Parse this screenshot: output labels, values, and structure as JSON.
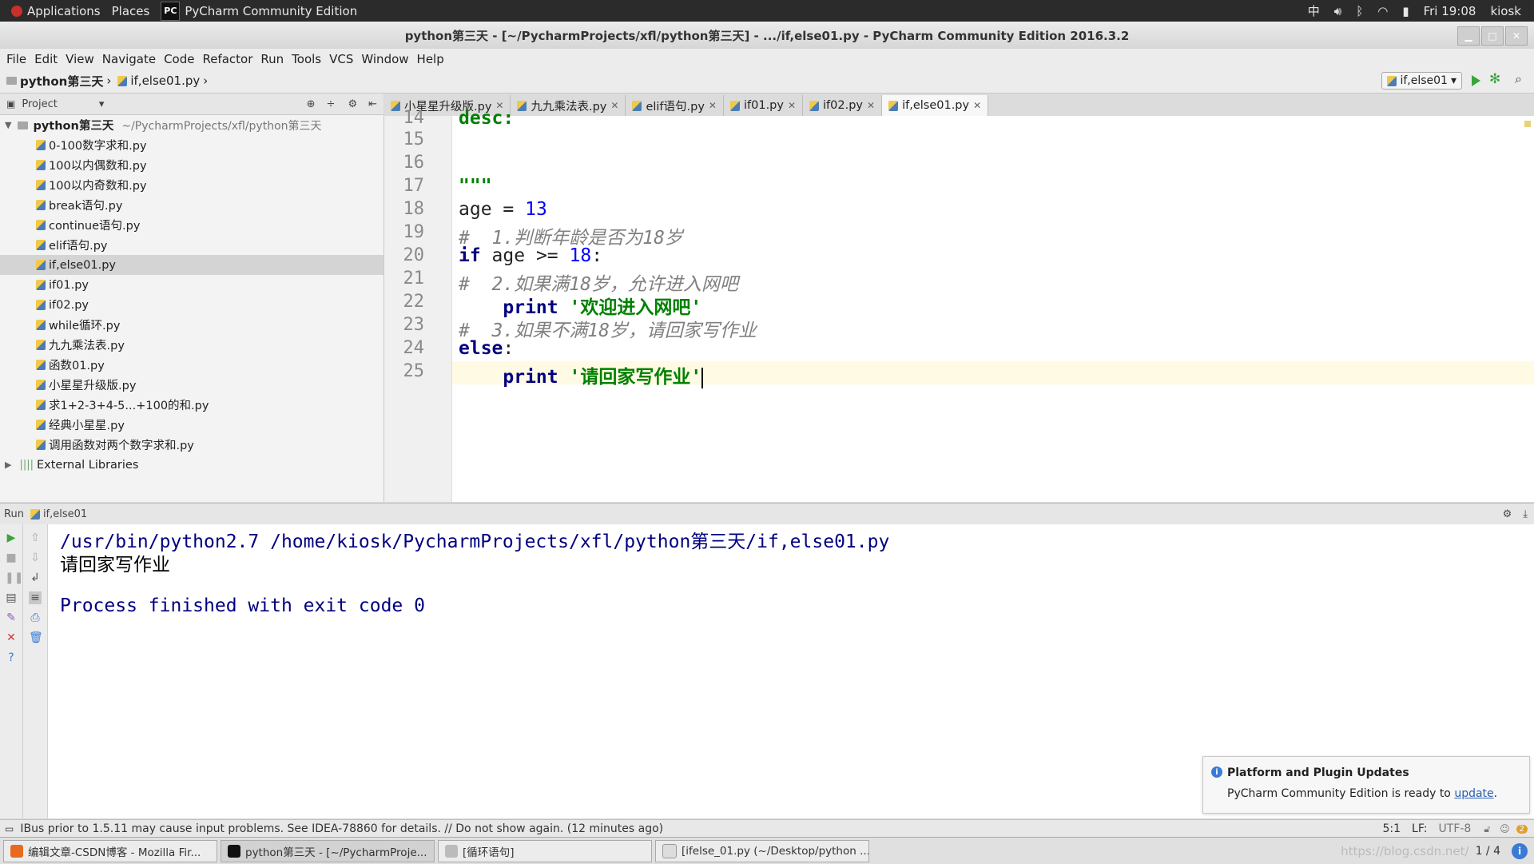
{
  "topbar": {
    "applications": "Applications",
    "places": "Places",
    "app_name": "PyCharm Community Edition",
    "app_icon_text": "PC",
    "input_method": "中",
    "clock": "Fri 19:08",
    "user": "kiosk"
  },
  "window": {
    "title": "python第三天 - [~/PycharmProjects/xfl/python第三天] - .../if,else01.py - PyCharm Community Edition 2016.3.2"
  },
  "menu": [
    "File",
    "Edit",
    "View",
    "Navigate",
    "Code",
    "Refactor",
    "Run",
    "Tools",
    "VCS",
    "Window",
    "Help"
  ],
  "breadcrumb": {
    "project": "python第三天",
    "file": "if,else01.py"
  },
  "run_config": "if,else01",
  "project_panel": {
    "label": "Project",
    "root_name": "python第三天",
    "root_path": "~/PycharmProjects/xfl/python第三天",
    "files": [
      "0-100数字求和.py",
      "100以内偶数和.py",
      "100以内奇数和.py",
      "break语句.py",
      "continue语句.py",
      "elif语句.py",
      "if,else01.py",
      "if01.py",
      "if02.py",
      "while循环.py",
      "九九乘法表.py",
      "函数01.py",
      "小星星升级版.py",
      "求1+2-3+4-5...+100的和.py",
      "经典小星星.py",
      "调用函数对两个数字求和.py"
    ],
    "selected_index": 6,
    "external": "External Libraries"
  },
  "tabs": [
    {
      "label": "小星星升级版.py",
      "active": false
    },
    {
      "label": "九九乘法表.py",
      "active": false
    },
    {
      "label": "elif语句.py",
      "active": false
    },
    {
      "label": "if01.py",
      "active": false
    },
    {
      "label": "if02.py",
      "active": false
    },
    {
      "label": "if,else01.py",
      "active": true
    }
  ],
  "editor": {
    "line_numbers": [
      "14",
      "15",
      "16",
      "17",
      "18",
      "19",
      "20",
      "21",
      "22",
      "23",
      "24",
      "25"
    ],
    "l14": "desc:",
    "l17": "\"\"\"",
    "l18_var": "age = ",
    "l18_num": "13",
    "l19": "#  1.判断年龄是否为18岁",
    "l20_kw": "if",
    "l20_mid": " age >= ",
    "l20_num": "18",
    "l20_end": ":",
    "l21": "#  2.如果满18岁，允许进入网吧",
    "l22_kw": "print",
    "l22_str": "'欢迎进入网吧'",
    "l23": "#  3.如果不满18岁，请回家写作业",
    "l24_kw": "else",
    "l24_end": ":",
    "l25_kw": "print",
    "l25_str": "'请回家写作业'"
  },
  "run_panel": {
    "label": "Run",
    "config": "if,else01",
    "console": {
      "command": "/usr/bin/python2.7 /home/kiosk/PycharmProjects/xfl/python第三天/if,else01.py",
      "output": "请回家写作业",
      "exit": "Process finished with exit code 0"
    }
  },
  "notification": {
    "title": "Platform and Plugin Updates",
    "text": "PyCharm Community Edition is ready to ",
    "link": "update",
    "after": "."
  },
  "status": {
    "message": "IBus prior to 1.5.11 may cause input problems. See IDEA-78860 for details. // Do not show again. (12 minutes ago)",
    "position": "5:1",
    "line_sep": "LF:",
    "encoding": "UTF-8",
    "badge": "2"
  },
  "taskbar": {
    "items": [
      "编辑文章-CSDN博客 - Mozilla Fir...",
      "python第三天 - [~/PycharmProje...",
      "[循环语句]",
      "[ifelse_01.py (~/Desktop/python ..."
    ],
    "active_index": 1,
    "pager": "1 / 4",
    "watermark": "https://blog.csdn.net/"
  },
  "colors": {
    "keyword": "#000080",
    "number": "#0000ff",
    "string": "#008000",
    "comment": "#808080",
    "console": "#000080"
  }
}
